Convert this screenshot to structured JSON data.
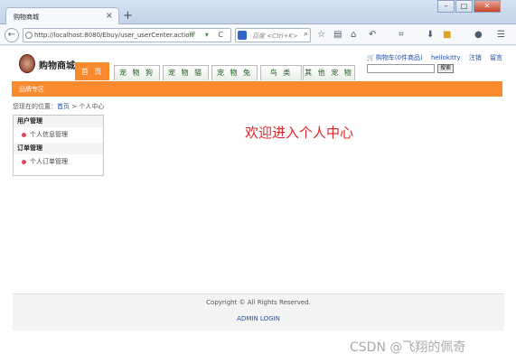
{
  "browser": {
    "tab_title": "购物商城",
    "tab_close": "×",
    "new_tab": "+",
    "url": "http://localhost:8080/Ebuy/user_userCenter.action",
    "search_placeholder": "百度 <Ctrl+K>",
    "back": "←",
    "reload": "C"
  },
  "site": {
    "logo_text": "购物商城",
    "nav": [
      "首 页",
      "宠 物 狗",
      "宠 物 猫",
      "宠 物 兔",
      "鸟 类",
      "其 他 宠 物"
    ],
    "toplinks": {
      "cart": "购物车(0件商品)",
      "user": "hellokitty",
      "logout": "注销",
      "message": "留言"
    },
    "search_button": "搜索",
    "subnav": "品牌专区",
    "breadcrumb": {
      "prefix": "您现在的位置：",
      "home": "首页",
      "current": " > 个人中心"
    },
    "sidebar": {
      "section1": "用户管理",
      "item1": "个人信息管理",
      "section2": "订单管理",
      "item2": "个人订单管理"
    },
    "welcome": "欢迎进入个人中心",
    "footer": {
      "copyright": "Copyright © All Rights Reserved.",
      "admin": "ADMIN LOGIN"
    }
  },
  "watermark": "CSDN @飞翔的佩奇"
}
